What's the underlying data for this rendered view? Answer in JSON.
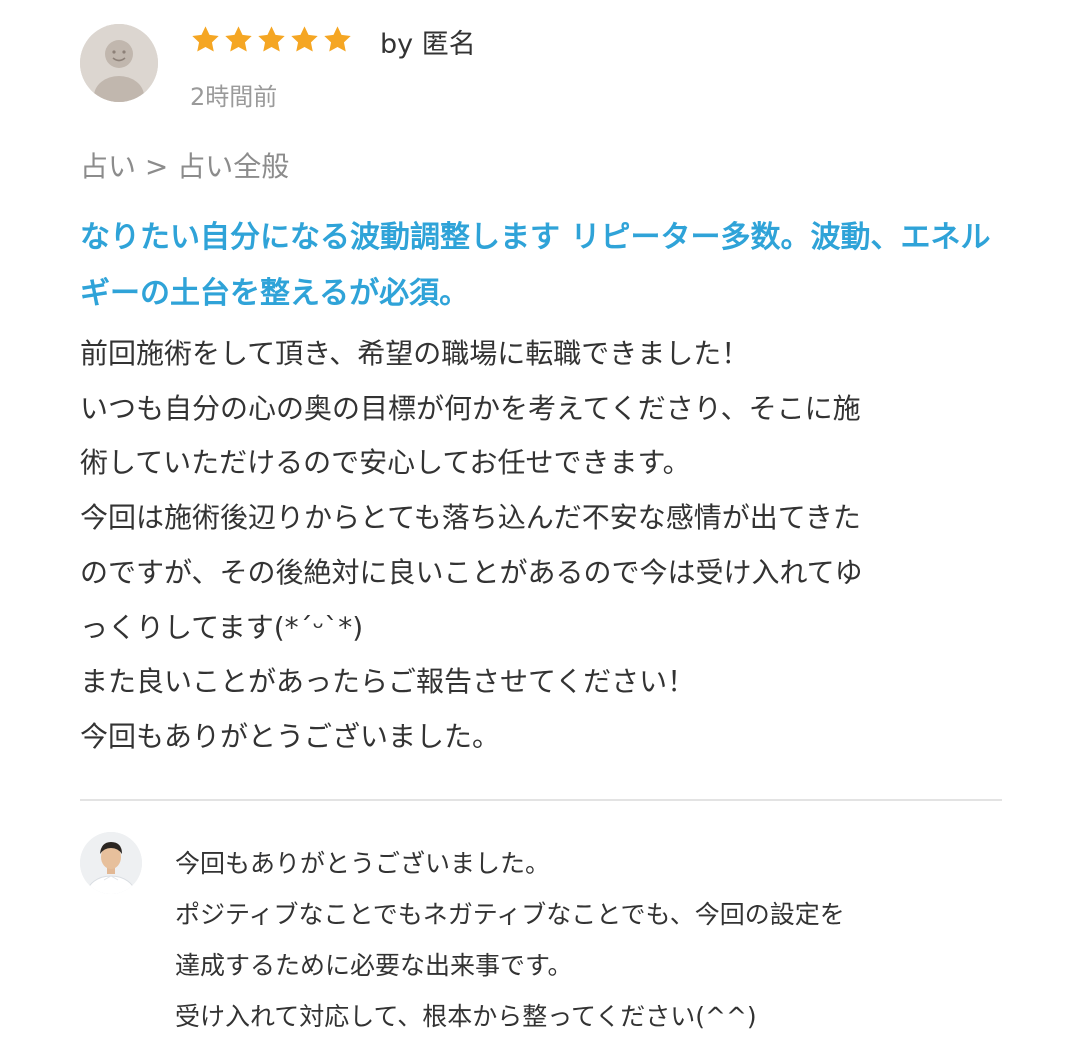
{
  "review": {
    "rating": 5,
    "star_color": "#f5a623",
    "reviewer_icon": "default-user-avatar",
    "byline": "by 匿名",
    "time_ago": "2時間前",
    "breadcrumb": {
      "category": "占い",
      "separator": ">",
      "subcategory": "占い全般"
    },
    "service_title": "なりたい自分になる波動調整します リピーター多数。波動、エネルギーの土台を整えるが必須。",
    "service_title_color": "#2fa3d8",
    "body_lines": [
      "前回施術をして頂き、希望の職場に転職できました！",
      "いつも自分の心の奥の目標が何かを考えてくださり、そこに施",
      "術していただけるので安心してお任せできます。",
      "今回は施術後辺りからとても落ち込んだ不安な感情が出てきた",
      "のですが、その後絶対に良いことがあるので今は受け入れてゆ",
      "っくりしてます(*´ᵕ`*)",
      "また良いことがあったらご報告させてください！",
      "今回もありがとうございました。"
    ]
  },
  "reply": {
    "seller_icon": "seller-photo-avatar",
    "lines": [
      "今回もありがとうございました。",
      "ポジティブなことでもネガティブなことでも、今回の設定を",
      "達成するために必要な出来事です。",
      "受け入れて対応して、根本から整ってください(^^)"
    ]
  }
}
